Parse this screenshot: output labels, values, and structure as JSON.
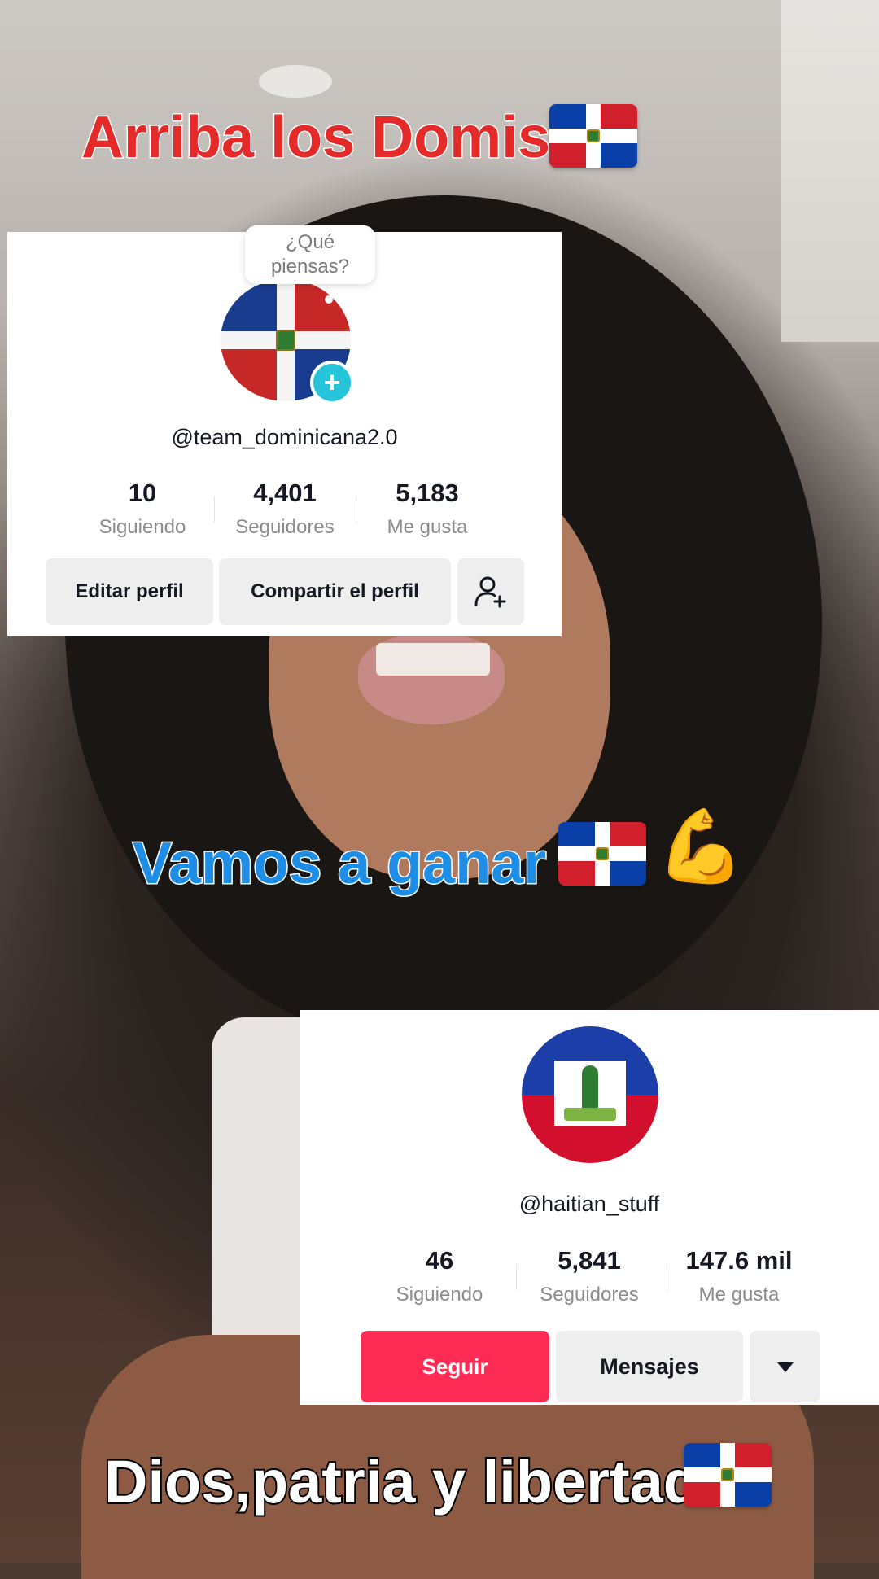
{
  "captions": {
    "top": "Arriba los Domis",
    "middle": "Vamos a ganar",
    "bottom": "Dios,patria y libertad"
  },
  "icons": {
    "flag": "dominican-republic-flag-icon",
    "muscle": "flexed-biceps-icon",
    "muscle_glyph": "💪"
  },
  "profile_own": {
    "bubble_text": "¿Qué piensas?",
    "handle": "@team_dominicana2.0",
    "stats": [
      {
        "value": "10",
        "label": "Siguiendo"
      },
      {
        "value": "4,401",
        "label": "Seguidores"
      },
      {
        "value": "5,183",
        "label": "Me gusta"
      }
    ],
    "edit_button": "Editar perfil",
    "share_button": "Compartir el perfil",
    "add_friend_icon": "add-friend-icon"
  },
  "profile_other": {
    "handle": "@haitian_stuff",
    "stats": [
      {
        "value": "46",
        "label": "Siguiendo"
      },
      {
        "value": "5,841",
        "label": "Seguidores"
      },
      {
        "value": "147.6 mil",
        "label": "Me gusta"
      }
    ],
    "follow_button": "Seguir",
    "message_button": "Mensajes",
    "more_icon": "caret-down-icon"
  },
  "colors": {
    "follow_button": "#fe2c55",
    "add_badge": "#25c4d8",
    "caption_top": "#e52a2a",
    "caption_middle": "#1e8de6"
  }
}
